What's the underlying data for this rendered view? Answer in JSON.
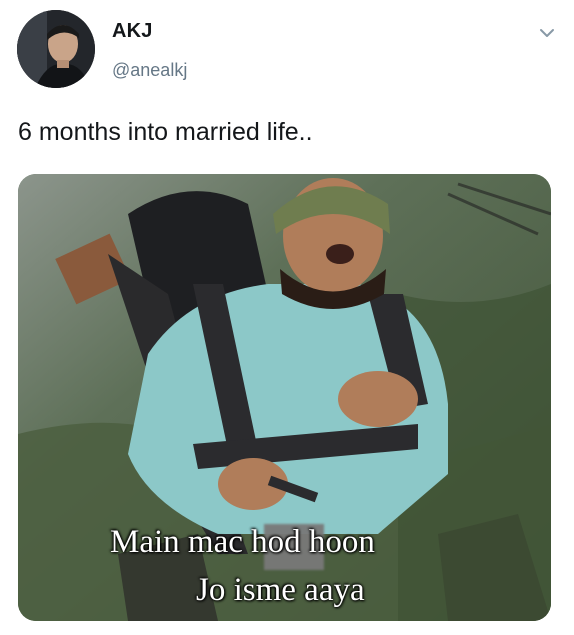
{
  "tweet": {
    "author": {
      "display_name": "AKJ",
      "handle": "@anealkj",
      "avatar_icon": "avatar-photo"
    },
    "menu_icon": "chevron-down-icon",
    "text": "6 months into married life..",
    "media": {
      "caption_line_1": "Main mac      hod hoon",
      "caption_line_2": "Jo isme aaya"
    }
  },
  "colors": {
    "text": "#14171a",
    "secondary_text": "#657786",
    "chevron": "#8899a6",
    "shirt": "#8cc8c8"
  }
}
